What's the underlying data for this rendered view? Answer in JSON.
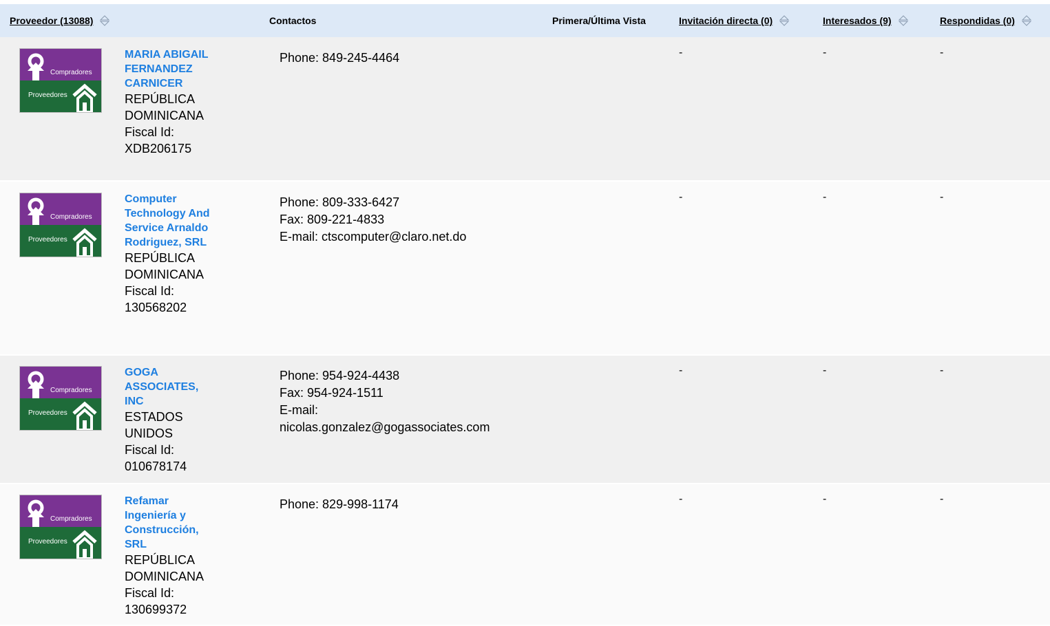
{
  "header": {
    "proveedor": "Proveedor (13088)",
    "contactos": "Contactos",
    "vista": "Primera/Última Vista",
    "invitacion": "Invitación directa (0)",
    "interesados": "Interesados (9)",
    "respondidas": "Respondidas (0)"
  },
  "logo": {
    "top_label": "Compradores",
    "bottom_label": "Proveedores",
    "top_color": "#7a3393",
    "bottom_color": "#1e6b39"
  },
  "colors": {
    "header_bg": "#dde9f7",
    "link": "#1e7fe0",
    "row_odd": "#f0f0f0",
    "row_even": "#fafafa"
  },
  "rows": [
    {
      "name": "MARIA ABIGAIL FERNANDEZ CARNICER",
      "country": "REPÚBLICA DOMINICANA",
      "fiscal": "Fiscal Id: XDB206175",
      "contacts": [
        "Phone: 849-245-4464"
      ],
      "invitacion": "-",
      "interesados": "-",
      "respondidas": "-"
    },
    {
      "name": "Computer Technology And Service Arnaldo Rodriguez, SRL",
      "country": "REPÚBLICA DOMINICANA",
      "fiscal": "Fiscal Id: 130568202",
      "contacts": [
        "Phone: 809-333-6427",
        "Fax: 809-221-4833",
        "E-mail: ctscomputer@claro.net.do"
      ],
      "invitacion": "-",
      "interesados": "-",
      "respondidas": "-"
    },
    {
      "name": "GOGA ASSOCIATES, INC",
      "country": "ESTADOS UNIDOS",
      "fiscal": "Fiscal Id: 010678174",
      "contacts": [
        "Phone: 954-924-4438",
        "Fax: 954-924-1511",
        "E-mail:",
        "nicolas.gonzalez@gogassociates.com"
      ],
      "invitacion": "-",
      "interesados": "-",
      "respondidas": "-"
    },
    {
      "name": "Refamar Ingeniería y Construcción, SRL",
      "country": "REPÚBLICA DOMINICANA",
      "fiscal": "Fiscal Id: 130699372",
      "contacts": [
        "Phone: 829-998-1174"
      ],
      "invitacion": "-",
      "interesados": "-",
      "respondidas": "-"
    }
  ]
}
